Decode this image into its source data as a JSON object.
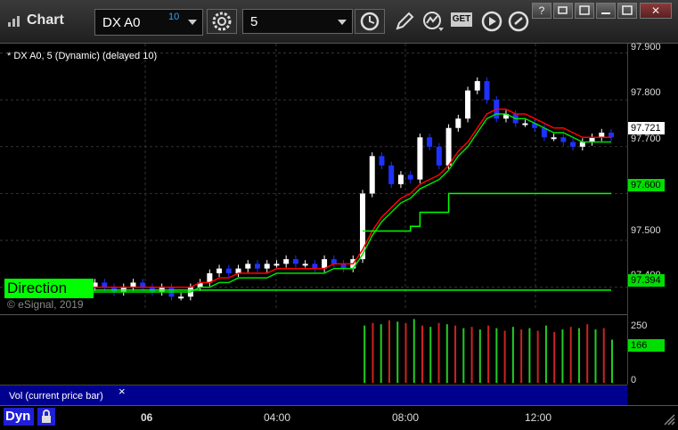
{
  "window": {
    "title": "Chart",
    "symbol": "DX A0",
    "link_number": "10",
    "interval": "5",
    "get_label": "GET",
    "controls": {
      "help": "?",
      "restore": "⧉",
      "minimize": "",
      "maximize": "",
      "close": "✕"
    }
  },
  "chart": {
    "label": "* DX A0, 5 (Dynamic) (delayed 10)",
    "study_label": "Direction",
    "copyright": "© eSignal, 2019",
    "price_axis": [
      "97.900",
      "97.800",
      "97.700",
      "97.600",
      "97.500",
      "97.400"
    ],
    "price_tags": {
      "last": "97.721",
      "upper_band": "97.600",
      "lower_band": "97.394"
    },
    "volume_axis": [
      "250",
      "0"
    ],
    "volume_tag": "166",
    "volume_label": "Vol (current price bar)",
    "volume_close": "×",
    "time_axis": [
      "06",
      "04:00",
      "08:00",
      "12:00"
    ],
    "dyn_label": "Dyn",
    "colors": {
      "background": "#000000",
      "up_bar": "#ffffff",
      "down_bar": "#1e32ff",
      "ma_red": "#ff0000",
      "ma_green": "#00e000",
      "band": "#00ff00",
      "vol_up": "#22cc22",
      "vol_down": "#cc2222",
      "vol_panel": "#00008f"
    }
  },
  "chart_data": {
    "type": "line",
    "title": "* DX A0, 5 (Dynamic) (delayed 10)",
    "xlabel": "",
    "ylabel": "",
    "x_ticks": [
      "06",
      "04:00",
      "08:00",
      "12:00"
    ],
    "ylim": [
      97.35,
      97.92
    ],
    "series": [
      {
        "values": [
          97.41,
          97.41,
          97.4,
          97.4,
          97.39,
          97.4,
          97.4,
          97.39,
          97.4,
          97.41,
          97.4,
          97.39,
          97.4,
          97.41,
          97.4,
          97.39,
          97.4,
          97.38,
          97.38,
          97.4,
          97.41,
          97.43,
          97.44,
          97.43,
          97.44,
          97.45,
          97.44,
          97.45,
          97.45,
          97.46,
          97.45,
          97.45,
          97.44,
          97.46,
          97.45,
          97.44,
          97.46,
          97.6,
          97.68,
          97.66,
          97.62,
          97.64,
          97.63,
          97.72,
          97.7,
          97.66,
          97.74,
          97.76,
          97.82,
          97.84,
          97.8,
          97.76,
          97.77,
          97.75,
          97.75,
          97.74,
          97.72,
          97.72,
          97.71,
          97.7,
          97.71,
          97.72,
          97.73,
          97.72
        ]
      },
      {
        "values": [
          97.4,
          97.4,
          97.4,
          97.4,
          97.4,
          97.4,
          97.4,
          97.4,
          97.4,
          97.4,
          97.4,
          97.4,
          97.4,
          97.4,
          97.4,
          97.4,
          97.4,
          97.4,
          97.4,
          97.4,
          97.41,
          97.41,
          97.42,
          97.42,
          97.43,
          97.43,
          97.43,
          97.43,
          97.44,
          97.44,
          97.44,
          97.44,
          97.44,
          97.44,
          97.45,
          97.45,
          97.45,
          97.48,
          97.52,
          97.55,
          97.57,
          97.59,
          97.6,
          97.62,
          97.63,
          97.64,
          97.66,
          97.69,
          97.71,
          97.74,
          97.77,
          97.78,
          97.78,
          97.77,
          97.77,
          97.76,
          97.75,
          97.74,
          97.74,
          97.73,
          97.72,
          97.72,
          97.72,
          97.72
        ]
      },
      {
        "values": [
          97.394,
          97.394,
          97.394,
          97.394,
          97.394,
          97.394,
          97.394,
          97.394,
          97.394,
          97.394,
          97.394,
          97.394,
          97.394,
          97.394,
          97.394,
          97.394,
          97.394,
          97.394,
          97.394,
          97.394,
          97.394,
          97.394,
          97.394,
          97.394,
          97.394,
          97.394,
          97.394,
          97.394,
          97.394,
          97.394,
          97.394,
          97.394,
          97.394,
          97.394,
          97.394,
          97.394,
          97.394,
          97.394,
          97.394,
          97.394,
          97.394,
          97.394,
          97.394,
          97.394,
          97.394,
          97.394,
          97.394,
          97.394,
          97.394,
          97.394,
          97.394,
          97.394,
          97.394,
          97.394,
          97.394,
          97.394,
          97.394,
          97.394,
          97.394,
          97.394,
          97.394,
          97.394,
          97.394,
          97.394
        ]
      },
      {
        "values": [
          null,
          null,
          null,
          null,
          null,
          null,
          null,
          null,
          null,
          null,
          null,
          null,
          null,
          null,
          null,
          null,
          null,
          null,
          null,
          null,
          null,
          null,
          null,
          null,
          null,
          null,
          null,
          null,
          null,
          null,
          null,
          null,
          null,
          null,
          null,
          null,
          null,
          97.52,
          97.52,
          97.52,
          97.52,
          97.52,
          97.53,
          97.56,
          97.56,
          97.56,
          97.6,
          97.6,
          97.6,
          97.6,
          97.6,
          97.6,
          97.6,
          97.6,
          97.6,
          97.6,
          97.6,
          97.6,
          97.6,
          97.6,
          97.6,
          97.6,
          97.6,
          97.6
        ]
      }
    ],
    "volume": [
      0,
      0,
      0,
      0,
      0,
      0,
      0,
      0,
      0,
      0,
      0,
      0,
      0,
      0,
      0,
      0,
      0,
      0,
      0,
      0,
      0,
      0,
      0,
      0,
      0,
      0,
      0,
      0,
      0,
      0,
      0,
      0,
      0,
      0,
      0,
      0,
      0,
      0,
      0,
      0,
      0,
      0,
      0,
      220,
      230,
      225,
      240,
      235,
      230,
      245,
      220,
      215,
      230,
      225,
      220,
      210,
      215,
      205,
      220,
      210,
      200,
      215,
      205,
      210,
      200,
      220,
      195,
      205,
      215,
      210,
      225,
      205,
      210,
      166
    ],
    "volume_ylim": [
      0,
      260
    ]
  }
}
